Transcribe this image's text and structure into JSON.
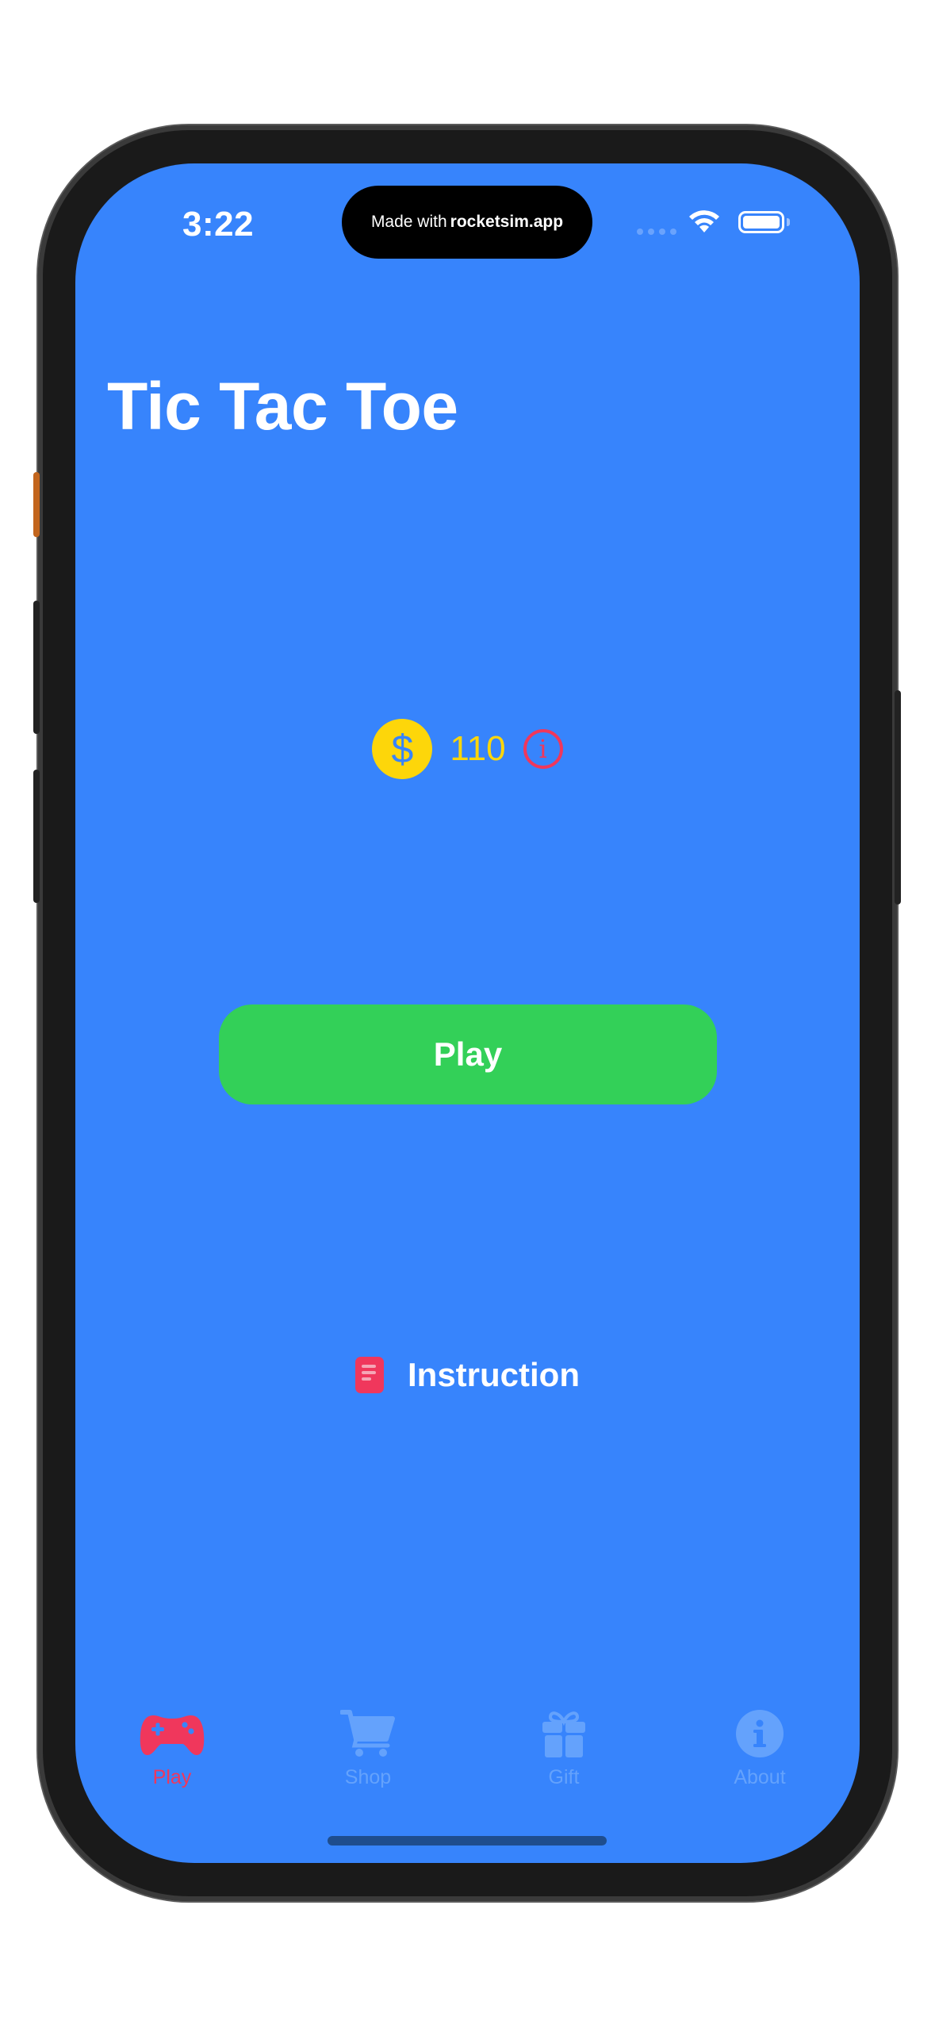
{
  "status_bar": {
    "time": "3:22",
    "island_prefix": "Made with",
    "island_brand": "rocketsim.app"
  },
  "page": {
    "title": "Tic Tac Toe"
  },
  "coins": {
    "symbol": "$",
    "count": "110",
    "info_glyph": "i"
  },
  "actions": {
    "play_label": "Play",
    "instruction_label": "Instruction"
  },
  "tabs": [
    {
      "label": "Play",
      "icon": "gamecontroller-icon",
      "active": true
    },
    {
      "label": "Shop",
      "icon": "cart-icon",
      "active": false
    },
    {
      "label": "Gift",
      "icon": "gift-icon",
      "active": false
    },
    {
      "label": "About",
      "icon": "info-circle-icon",
      "active": false
    }
  ],
  "colors": {
    "background": "#3784fc",
    "accent_red": "#f0375c",
    "coin_yellow": "#fdd60a",
    "play_green": "#33d058",
    "tab_inactive": "#64a2fc"
  }
}
